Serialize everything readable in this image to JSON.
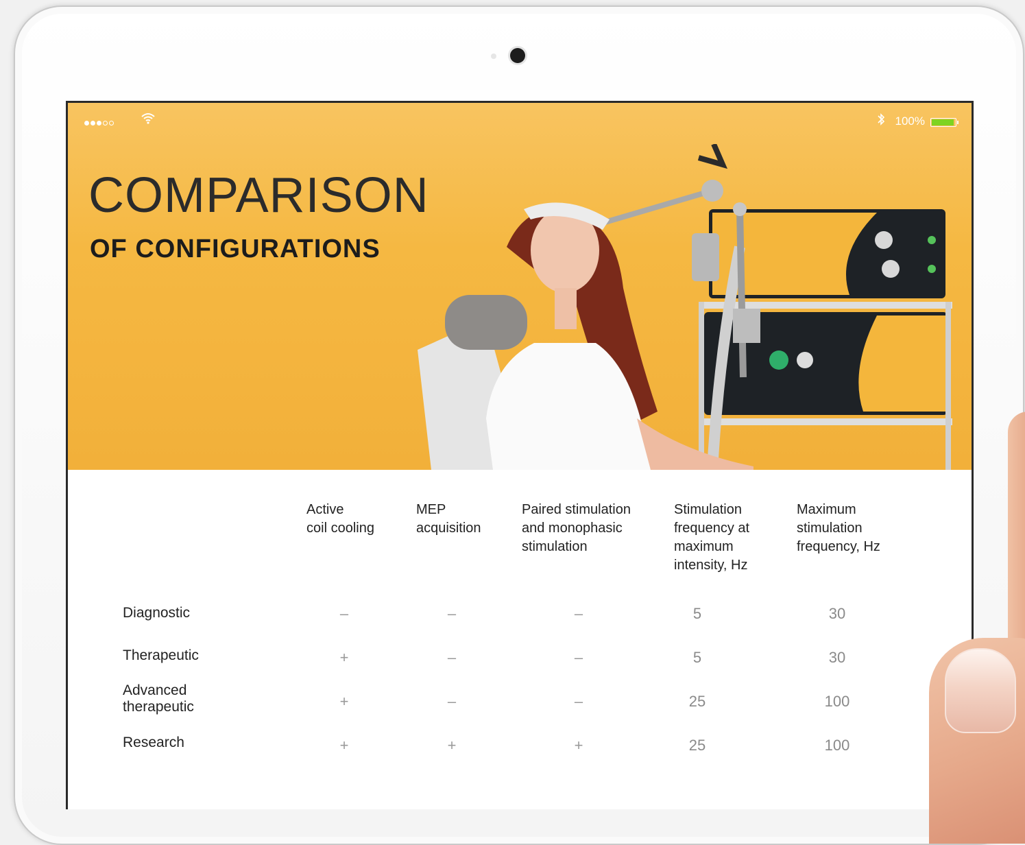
{
  "status_bar": {
    "battery_percent": "100%",
    "battery_level": 1.0,
    "signal_icon": "signal-dots-icon",
    "wifi_icon": "wifi-icon",
    "bluetooth_icon": "bluetooth-icon"
  },
  "hero": {
    "title": "COMPARISON",
    "subtitle": "OF CONFIGURATIONS",
    "accent_color": "#f5b842"
  },
  "table": {
    "columns": [
      "Active\ncoil cooling",
      "MEP\nacquisition",
      "Paired stimulation\nand monophasic\nstimulation",
      "Stimulation\nfrequency at\nmaximum\nintensity, Hz",
      "Maximum\nstimulation\nfrequency, Hz"
    ],
    "rows": [
      {
        "label": "Diagnostic",
        "cells": [
          "–",
          "–",
          "–",
          "5",
          "30"
        ]
      },
      {
        "label": "Therapeutic",
        "cells": [
          "+",
          "–",
          "–",
          "5",
          "30"
        ]
      },
      {
        "label": "Advanced\ntherapeutic",
        "cells": [
          "+",
          "–",
          "–",
          "25",
          "100"
        ]
      },
      {
        "label": "Research",
        "cells": [
          "+",
          "+",
          "+",
          "25",
          "100"
        ]
      }
    ]
  }
}
